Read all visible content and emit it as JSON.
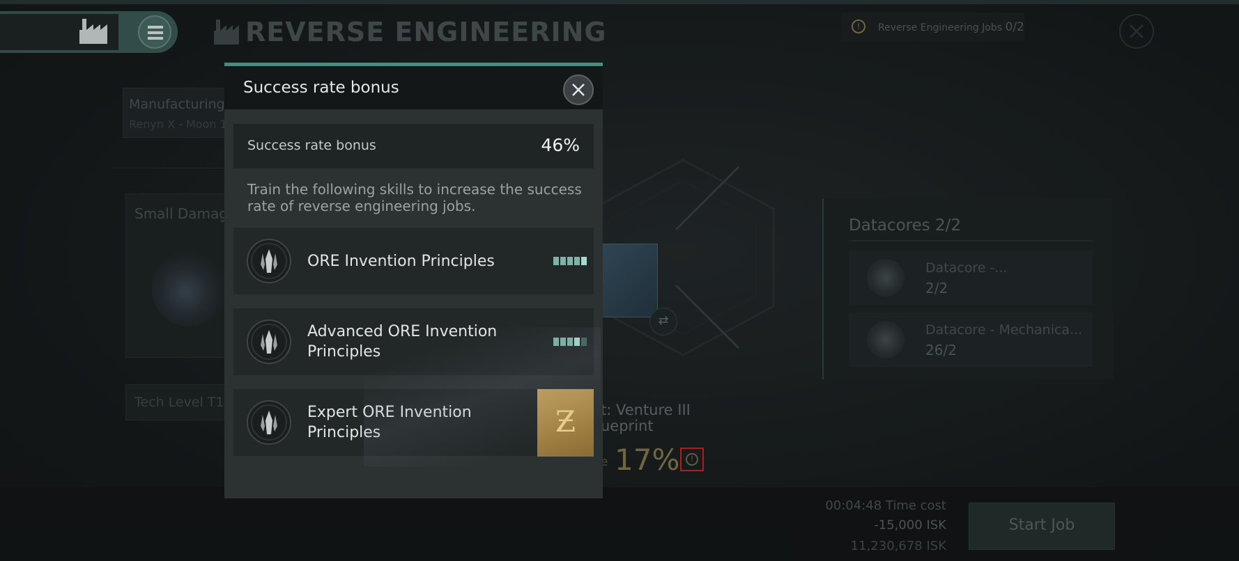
{
  "header": {
    "title": "REVERSE ENGINEERING",
    "jobs_label": "Reverse Engineering Jobs",
    "jobs_count": "0/2"
  },
  "manufacturing": {
    "label": "Manufacturing",
    "location": "Renyn X - Moon 1"
  },
  "left_card": {
    "title": "Small Damag",
    "tech_level": "Tech Level T1"
  },
  "product": {
    "name_line1": "t: Venture III",
    "name_line2": "ueprint",
    "rate_label": "e",
    "success_rate": "17%"
  },
  "datacores": {
    "title": "Datacores 2/2",
    "items": [
      {
        "name": "Datacore -...",
        "count": "2/2"
      },
      {
        "name": "Datacore - Mechanica...",
        "count": "26/2"
      }
    ]
  },
  "footer": {
    "time_cost": "00:04:48  Time cost",
    "isk_cost": "-15,000 ISK",
    "balance": "11,230,678 ISK",
    "start_label": "Start Job"
  },
  "modal": {
    "title": "Success rate bonus",
    "rate_label": "Success rate bonus",
    "rate_value": "46%",
    "description": "Train the following skills to increase the success rate of reverse engineering jobs.",
    "skills": [
      {
        "name": "ORE Invention Principles",
        "level": 5
      },
      {
        "name": "Advanced ORE Invention Principles",
        "level": 4
      },
      {
        "name": "Expert ORE Invention Principles",
        "omega_symbol": "Ƶ"
      }
    ]
  },
  "colors": {
    "accent": "#4f8a80",
    "omega": "#c5a15a",
    "warning_highlight": "#e01e1e"
  }
}
